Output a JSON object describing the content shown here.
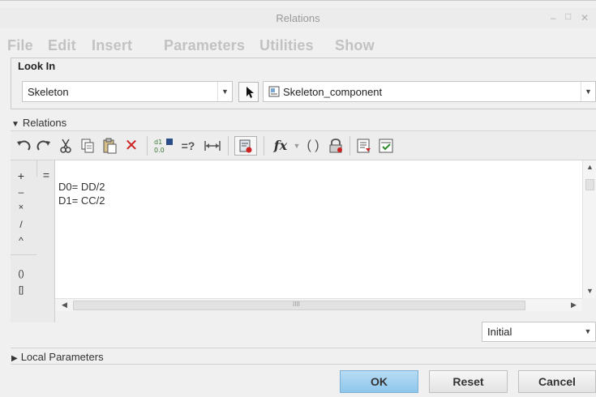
{
  "window": {
    "title": "Relations",
    "min_icon": "minimize-icon",
    "max_icon": "maximize-icon",
    "close_icon": "close-icon"
  },
  "menubar": {
    "items": [
      "File",
      "Edit",
      "Insert",
      "Parameters",
      "Utilities",
      "Show"
    ]
  },
  "look_in": {
    "legend": "Look In",
    "type_value": "Skeleton",
    "component_value": "Skeleton_component"
  },
  "relations_section": {
    "label": "Relations"
  },
  "toolbar": {
    "icons": [
      "undo-icon",
      "redo-icon",
      "cut-icon",
      "copy-icon",
      "paste-icon",
      "delete-icon",
      "sort-relations-icon",
      "evaluate-icon",
      "insert-dimension-icon",
      "show-dimensions-icon",
      "function-icon",
      "parameters-icon",
      "lock-icon",
      "verify-icon",
      "check-icon"
    ],
    "evaluate_label": "=?",
    "function_label": "fx"
  },
  "operators": {
    "plus": "+",
    "equals": "=",
    "minus": "–",
    "times": "×",
    "divide": "/",
    "power": "^",
    "paren": "()",
    "bracket": "[]"
  },
  "editor": {
    "lines": [
      "D0= DD/2",
      "D1= CC/2"
    ]
  },
  "scrollbar": {
    "h_grip": "IIII"
  },
  "sort_select": {
    "value": "Initial"
  },
  "local_parameters": {
    "label": "Local Parameters"
  },
  "buttons": {
    "ok": "OK",
    "reset": "Reset",
    "cancel": "Cancel"
  }
}
